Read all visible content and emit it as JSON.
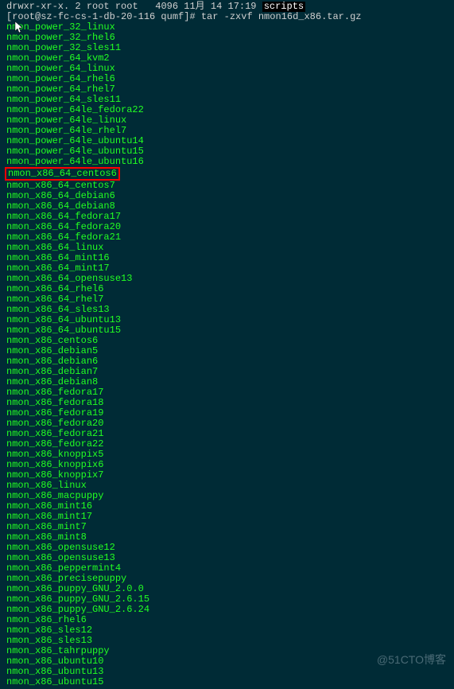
{
  "terminal": {
    "partial_ls": {
      "perms": "drwxr-xr-x.",
      "links": "2",
      "owner": "root",
      "group": "root",
      "gap": "   ",
      "size": "4096",
      "date": "11月 14 17:19 "
    },
    "scripts_label": "scripts",
    "prompt_user": "[root@sz-fc-cs-1-db-20-116 qumf]# ",
    "command": "tar -zxvf nmon16d_x86.tar.gz",
    "highlighted_file": "nmon_x86_64_centos6",
    "files": [
      "nmon_power_32_linux",
      "nmon_power_32_rhel6",
      "nmon_power_32_sles11",
      "nmon_power_64_kvm2",
      "nmon_power_64_linux",
      "nmon_power_64_rhel6",
      "nmon_power_64_rhel7",
      "nmon_power_64_sles11",
      "nmon_power_64le_fedora22",
      "nmon_power_64le_linux",
      "nmon_power_64le_rhel7",
      "nmon_power_64le_ubuntu14",
      "nmon_power_64le_ubuntu15",
      "nmon_power_64le_ubuntu16",
      "HIGHLIGHT",
      "nmon_x86_64_centos7",
      "nmon_x86_64_debian6",
      "nmon_x86_64_debian8",
      "nmon_x86_64_fedora17",
      "nmon_x86_64_fedora20",
      "nmon_x86_64_fedora21",
      "nmon_x86_64_linux",
      "nmon_x86_64_mint16",
      "nmon_x86_64_mint17",
      "nmon_x86_64_opensuse13",
      "nmon_x86_64_rhel6",
      "nmon_x86_64_rhel7",
      "nmon_x86_64_sles13",
      "nmon_x86_64_ubuntu13",
      "nmon_x86_64_ubuntu15",
      "nmon_x86_centos6",
      "nmon_x86_debian5",
      "nmon_x86_debian6",
      "nmon_x86_debian7",
      "nmon_x86_debian8",
      "nmon_x86_fedora17",
      "nmon_x86_fedora18",
      "nmon_x86_fedora19",
      "nmon_x86_fedora20",
      "nmon_x86_fedora21",
      "nmon_x86_fedora22",
      "nmon_x86_knoppix5",
      "nmon_x86_knoppix6",
      "nmon_x86_knoppix7",
      "nmon_x86_linux",
      "nmon_x86_macpuppy",
      "nmon_x86_mint16",
      "nmon_x86_mint17",
      "nmon_x86_mint7",
      "nmon_x86_mint8",
      "nmon_x86_opensuse12",
      "nmon_x86_opensuse13",
      "nmon_x86_peppermint4",
      "nmon_x86_precisepuppy",
      "nmon_x86_puppy_GNU_2.0.0",
      "nmon_x86_puppy_GNU_2.6.15",
      "nmon_x86_puppy_GNU_2.6.24",
      "nmon_x86_rhel6",
      "nmon_x86_sles12",
      "nmon_x86_sles13",
      "nmon_x86_tahrpuppy",
      "nmon_x86_ubuntu10",
      "nmon_x86_ubuntu13",
      "nmon_x86_ubuntu15"
    ]
  },
  "watermark": "@51CTO博客"
}
